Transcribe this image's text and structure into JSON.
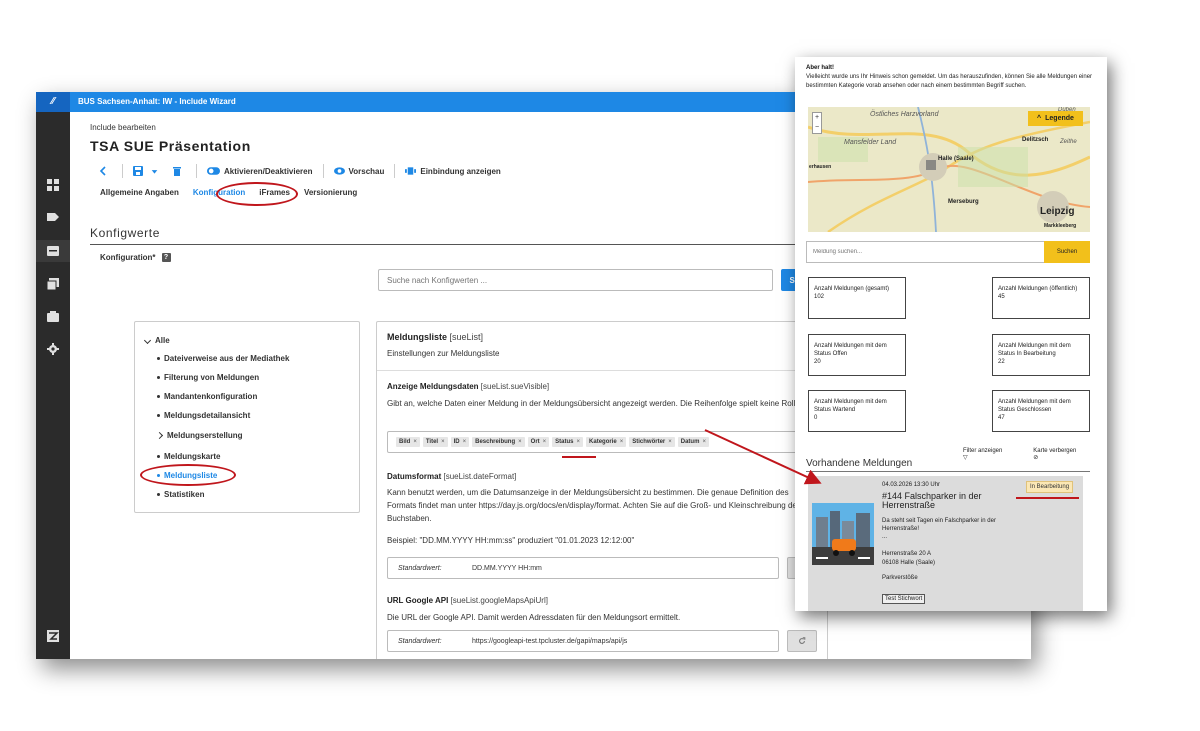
{
  "app": {
    "window_title": "BUS Sachsen-Anhalt: IW - Include Wizard",
    "breadcrumb": "Include bearbeiten",
    "page_title": "TSA SUE Präsentation",
    "toolbar": {
      "activate": "Aktivieren/Deaktivieren",
      "preview": "Vorschau",
      "embed": "Einbindung anzeigen"
    },
    "tabs": [
      "Allgemeine Angaben",
      "Konfiguration",
      "iFrames",
      "Versionierung"
    ],
    "active_tab": "Konfiguration",
    "section_title": "Konfigwerte",
    "config_label": "Konfiguration*",
    "search": {
      "placeholder": "Suche nach Konfigwerten ...",
      "button": "Suchen"
    },
    "tree": {
      "root": "Alle",
      "items": [
        "Dateiverweise aus der Mediathek",
        "Filterung von Meldungen",
        "Mandantenkonfiguration",
        "Meldungsdetailansicht",
        "Meldungserstellung",
        "Meldungskarte",
        "Meldungsliste",
        "Statistiken"
      ],
      "active": "Meldungsliste"
    },
    "panel": {
      "title": "Meldungsliste",
      "key": "[sueList]",
      "subtitle": "Einstellungen zur Meldungsliste",
      "visible": {
        "title": "Anzeige Meldungsdaten",
        "key": "[sueList.sueVisible]",
        "text": "Gibt an, welche Daten einer Meldung in der Meldungsübersicht angezeigt werden. Die Reihenfolge spielt keine Rolle.",
        "chips": [
          "Bild",
          "Titel",
          "ID",
          "Beschreibung",
          "Ort",
          "Status",
          "Kategorie",
          "Stichwörter",
          "Datum"
        ]
      },
      "date_format": {
        "title": "Datumsformat",
        "key": "[sueList.dateFormat]",
        "text": "Kann benutzt werden, um die Datumsanzeige in der Meldungsübersicht zu bestimmen. Die genaue Definition des Formats findet man unter https://day.js.org/docs/en/display/format. Achten Sie auf die Groß- und Kleinschreibung der Buchstaben.",
        "example": "Beispiel: \"DD.MM.YYYY HH:mm:ss\" produziert \"01.01.2023 12:12:00\"",
        "std_label": "Standardwert:",
        "std_value": "DD.MM.YYYY HH:mm"
      },
      "google_api": {
        "title": "URL Google API",
        "key": "[sueList.googleMapsApiUrl]",
        "text": "Die URL der Google API. Damit werden Adressdaten für den Meldungsort ermittelt.",
        "std_label": "Standardwert:",
        "std_value": "https://googleapi-test.tpcluster.de/gapi/maps/api/js"
      }
    }
  },
  "front": {
    "hint_title": "Aber halt!",
    "hint_text": "Vielleicht wurde uns Ihr Hinweis schon gemeldet. Um das herauszufinden, können Sie alle Meldungen einer bestimmten Kategorie vorab ansehen oder nach einem bestimmten Begriff suchen.",
    "map": {
      "legend": "Legende",
      "zoom_in": "+",
      "zoom_out": "−",
      "labels": [
        "Östliches Harzvorland",
        "Mansfelder Land",
        "Halle (Saale)",
        "Merseburg",
        "Leipzig",
        "Delitzsch",
        "Markkleeberg",
        "erhausen",
        "Düben",
        "Zeithe"
      ]
    },
    "search": {
      "placeholder": "Meldung suchen...",
      "button": "Suchen"
    },
    "stats": [
      {
        "label": "Anzahl Meldungen (gesamt)",
        "value": "102"
      },
      {
        "label": "Anzahl Meldungen (öffentlich)",
        "value": "45"
      },
      {
        "label": "Anzahl Meldungen mit dem Status Offen",
        "value": "20"
      },
      {
        "label": "Anzahl Meldungen mit dem Status In Bearbeitung",
        "value": "22"
      },
      {
        "label": "Anzahl Meldungen mit dem Status Wartend",
        "value": "0"
      },
      {
        "label": "Anzahl Meldungen mit dem Status Geschlossen",
        "value": "47"
      }
    ],
    "filter_label": "Filter anzeigen",
    "map_toggle_label": "Karte verbergen",
    "list_title": "Vorhandene Meldungen",
    "card": {
      "date": "04.03.2026 13:30 Uhr",
      "status": "In Bearbeitung",
      "title": "#144 Falschparker in der Herrenstraße",
      "desc": "Da steht seit Tagen ein Falschparker in der Herrenstraße!",
      "ellipsis": "...",
      "address_line1": "Herrenstraße 20 A",
      "address_line2": "06108 Halle (Saale)",
      "category": "Parkverstöße",
      "tag": "Test Stichwort"
    }
  },
  "colors": {
    "primary": "#1e88e5",
    "accent_yellow": "#f2c01b",
    "annotation_red": "#c0161c",
    "sidebar": "#2b2b2b"
  }
}
